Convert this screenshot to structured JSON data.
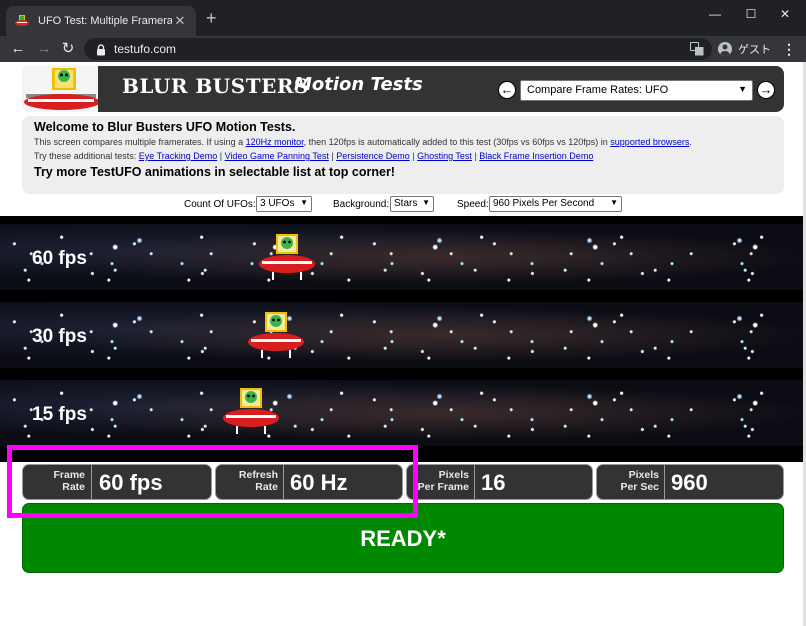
{
  "browser": {
    "tab_title": "UFO Test: Multiple Framerates",
    "tab_close": "✕",
    "new_tab": "+",
    "url": "testufo.com",
    "profile_label": "ゲスト",
    "window_controls": {
      "minimize": "—",
      "maximize": "☐",
      "close": "✕"
    },
    "nav": {
      "back": "←",
      "forward": "→",
      "reload": "↻"
    }
  },
  "banner": {
    "title": "BLUR BUSTERS",
    "subtitle": "Motion Tests",
    "prev": "←",
    "next": "→",
    "test_select_value": "Compare Frame Rates: UFO"
  },
  "info": {
    "heading": "Welcome to Blur Busters UFO Motion Tests.",
    "line1_a": "This screen compares multiple framerates. If using a ",
    "line1_link1": "120Hz monitor",
    "line1_b": ", then 120fps is automatically added to this test (30fps vs 60fps vs 120fps) in ",
    "line1_link2": "supported browsers",
    "line1_c": ".",
    "line2_prefix": "Try these additional tests: ",
    "links": [
      "Eye Tracking Demo",
      "Video Game Panning Test",
      "Persistence Demo",
      "Ghosting Test",
      "Black Frame Insertion Demo"
    ],
    "separator": " | ",
    "more": "Try more TestUFO animations in selectable list at top corner!"
  },
  "options": {
    "count_label": "Count Of UFOs:",
    "count_value": "3 UFOs",
    "background_label": "Background:",
    "background_value": "Stars",
    "speed_label": "Speed:",
    "speed_value": "960 Pixels Per Second"
  },
  "lanes": [
    {
      "label": "60 fps"
    },
    {
      "label": "30 fps"
    },
    {
      "label": "15 fps"
    }
  ],
  "stats": {
    "frame_rate_label_1": "Frame",
    "frame_rate_label_2": "Rate",
    "frame_rate_value": "60 fps",
    "refresh_label_1": "Refresh",
    "refresh_label_2": "Rate",
    "refresh_value": "60 Hz",
    "ppf_label_1": "Pixels",
    "ppf_label_2": "Per Frame",
    "ppf_value": "16",
    "pps_label_1": "Pixels",
    "pps_label_2": "Per Sec",
    "pps_value": "960"
  },
  "status": {
    "ready": "READY*"
  },
  "colors": {
    "highlight": "#ff00ff",
    "ready_bg": "#008800",
    "banner_bg": "#333333"
  }
}
